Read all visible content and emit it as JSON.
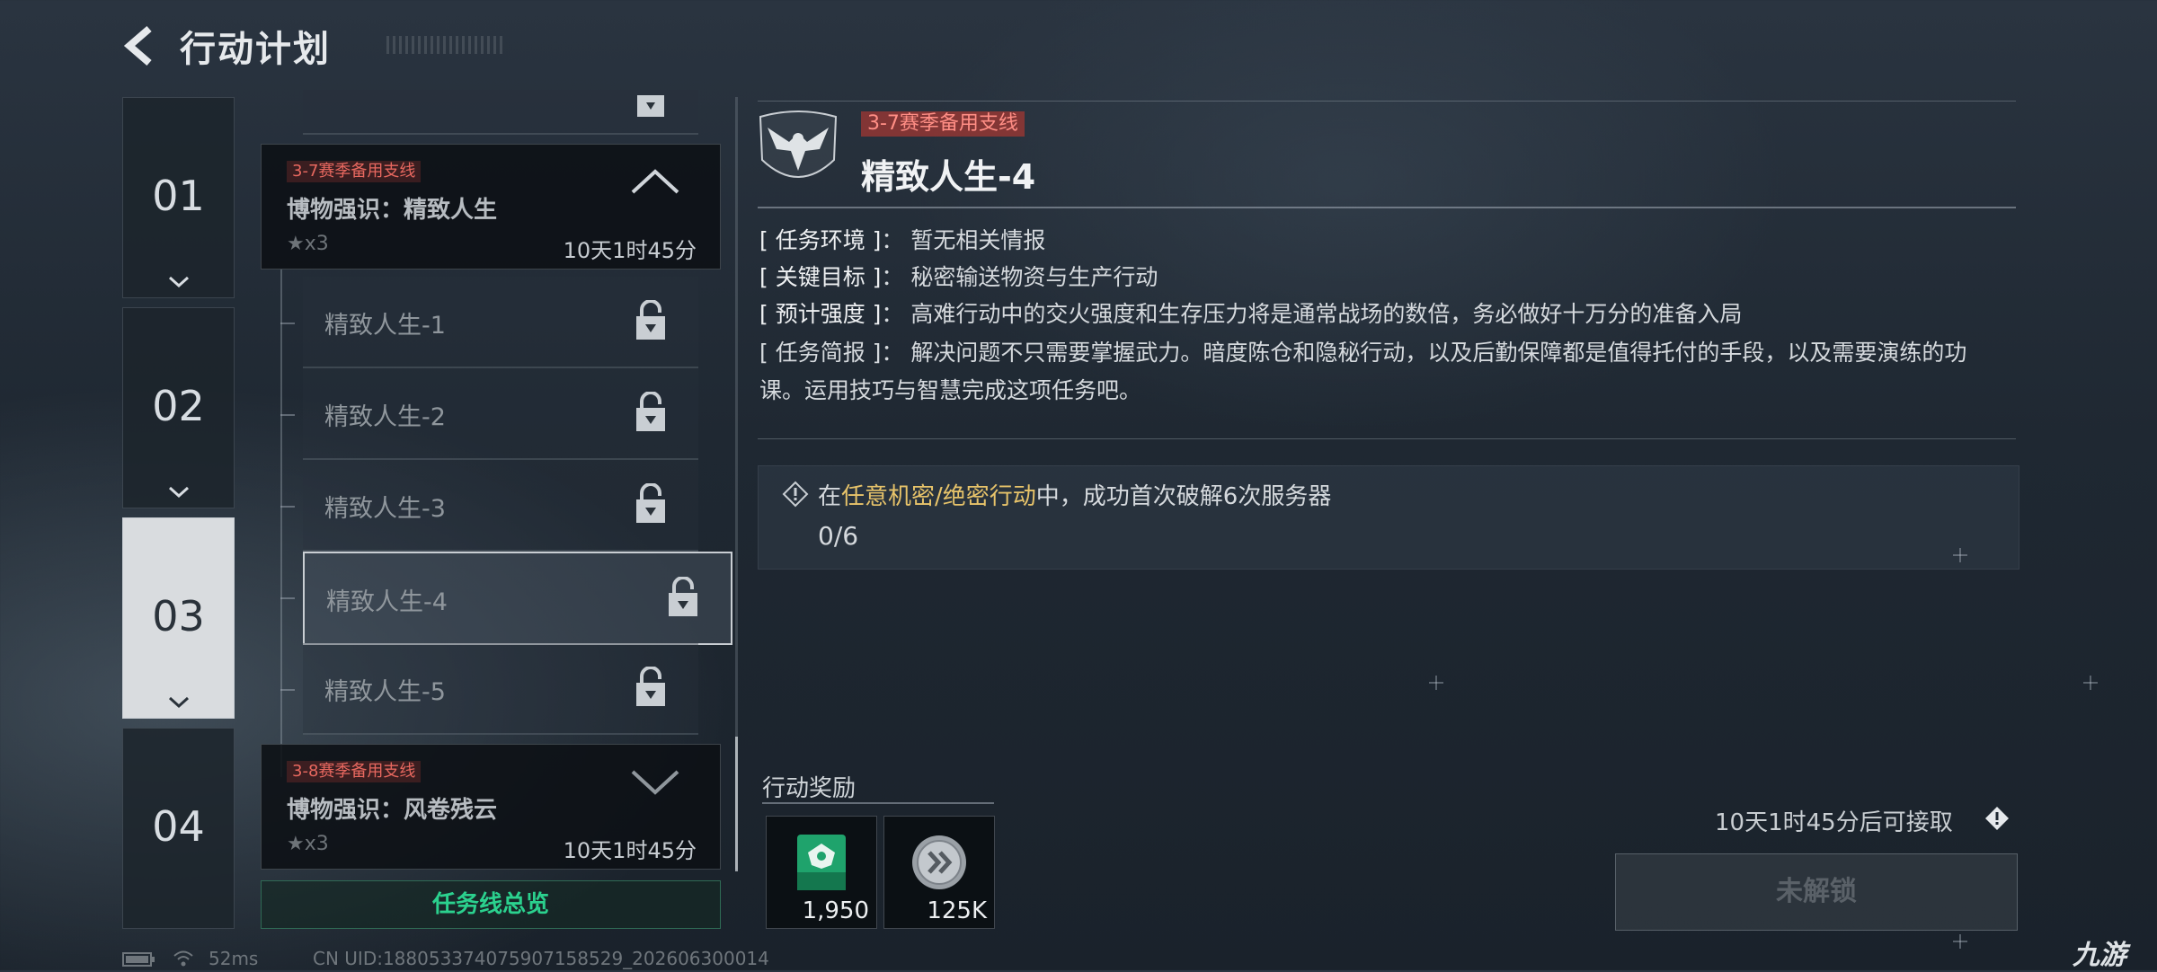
{
  "header": {
    "title": "行动计划"
  },
  "chapters": [
    {
      "num": "01",
      "active": false
    },
    {
      "num": "02",
      "active": false
    },
    {
      "num": "03",
      "active": true
    },
    {
      "num": "04",
      "active": false
    }
  ],
  "list": {
    "group_top": {
      "tag": "3-7赛季备用支线",
      "title": "博物强识：精致人生",
      "stars": "★x3",
      "time": "10天1时45分"
    },
    "items": [
      {
        "label": "精致人生-1"
      },
      {
        "label": "精致人生-2"
      },
      {
        "label": "精致人生-3"
      },
      {
        "label": "精致人生-4"
      },
      {
        "label": "精致人生-5"
      }
    ],
    "group_bottom": {
      "tag": "3-8赛季备用支线",
      "title": "博物强识：风卷残云",
      "stars": "★x3",
      "time": "10天1时45分"
    },
    "overview_label": "任务线总览"
  },
  "detail": {
    "tag": "3-7赛季备用支线",
    "title": "精致人生-4",
    "env_key": "[ 任务环境 ]",
    "env_val": "暂无相关情报",
    "target_key": "[ 关键目标 ]",
    "target_val": "秘密输送物资与生产行动",
    "intensity_key": "[ 预计强度 ]",
    "intensity_val": "高难行动中的交火强度和生存压力将是通常战场的数倍，务必做好十万分的准备入局",
    "brief_key": "[ 任务简报 ]",
    "brief_val": "解决问题不只需要掌握武力。暗度陈仓和隐秘行动，以及后勤保障都是值得托付的手段，以及需要演练的功课。运用技巧与智慧完成这项任务吧。",
    "objective": {
      "prefix": "在",
      "highlight": "任意机密/绝密行动",
      "suffix": "中，成功首次破解6次服务器",
      "progress": "0/6",
      "highlight_color": "#e7c36a"
    },
    "reward_label": "行动奖励",
    "rewards": [
      {
        "amount": "1,950",
        "icon": "experience-card-icon"
      },
      {
        "amount": "125K",
        "icon": "coin-icon"
      }
    ],
    "available_text": "10天1时45分后可接取",
    "locked_label": "未解锁"
  },
  "status": {
    "ping": "52ms",
    "uid": "CN UID:18805337407590715852​9_202606300014"
  },
  "watermark": "九游"
}
